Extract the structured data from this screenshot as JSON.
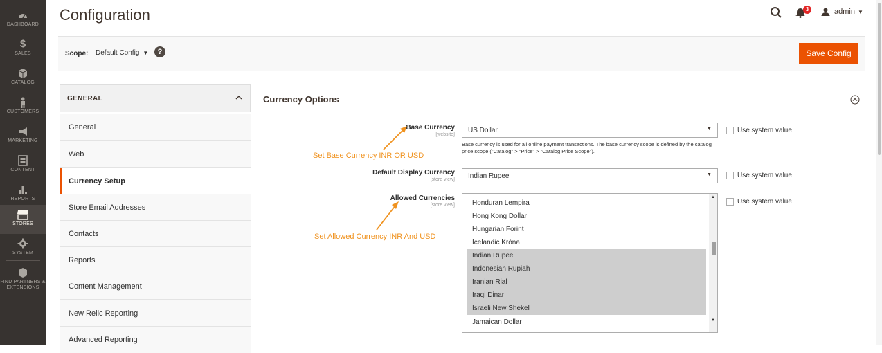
{
  "menu": [
    {
      "label": "DASHBOARD",
      "icon": "dashboard-icon"
    },
    {
      "label": "SALES",
      "icon": "dollar-icon"
    },
    {
      "label": "CATALOG",
      "icon": "cube-icon"
    },
    {
      "label": "CUSTOMERS",
      "icon": "person-icon"
    },
    {
      "label": "MARKETING",
      "icon": "megaphone-icon"
    },
    {
      "label": "CONTENT",
      "icon": "layout-icon"
    },
    {
      "label": "REPORTS",
      "icon": "bar-chart-icon"
    },
    {
      "label": "STORES",
      "icon": "store-icon"
    },
    {
      "label": "SYSTEM",
      "icon": "gear-icon"
    },
    {
      "label": "FIND PARTNERS & EXTENSIONS",
      "icon": "box-icon"
    }
  ],
  "header": {
    "title": "Configuration",
    "notifications_count": "3",
    "user": "admin"
  },
  "scope": {
    "label": "Scope:",
    "value": "Default Config",
    "help": "?",
    "save_label": "Save Config"
  },
  "tabs": {
    "heading": "GENERAL",
    "items": [
      "General",
      "Web",
      "Currency Setup",
      "Store Email Addresses",
      "Contacts",
      "Reports",
      "Content Management",
      "New Relic Reporting",
      "Advanced Reporting"
    ],
    "active": "Currency Setup"
  },
  "section": {
    "title": "Currency Options",
    "base": {
      "label": "Base Currency",
      "scope": "[website]",
      "value": "US Dollar",
      "note": "Base currency is used for all online payment transactions. The base currency scope is defined by the catalog price scope (\"Catalog\" > \"Price\" > \"Catalog Price Scope\")."
    },
    "display": {
      "label": "Default Display Currency",
      "scope": "[store view]",
      "value": "Indian Rupee"
    },
    "allowed": {
      "label": "Allowed Currencies",
      "scope": "[store view]",
      "options": [
        {
          "text": "Honduran Lempira",
          "selected": false
        },
        {
          "text": "Hong Kong Dollar",
          "selected": false
        },
        {
          "text": "Hungarian Forint",
          "selected": false
        },
        {
          "text": "Icelandic Króna",
          "selected": false
        },
        {
          "text": "Indian Rupee",
          "selected": true
        },
        {
          "text": "Indonesian Rupiah",
          "selected": true
        },
        {
          "text": "Iranian Rial",
          "selected": true
        },
        {
          "text": "Iraqi Dinar",
          "selected": true
        },
        {
          "text": "Israeli New Shekel",
          "selected": true
        },
        {
          "text": "Jamaican Dollar",
          "selected": false
        }
      ]
    },
    "use_system_value": "Use system value"
  },
  "annotations": {
    "base": "Set Base Currency INR OR USD",
    "allowed": "Set Allowed Currency INR And USD",
    "color": "#f0921e"
  },
  "colors": {
    "accent": "#eb5202",
    "menu_bg": "#373330"
  }
}
